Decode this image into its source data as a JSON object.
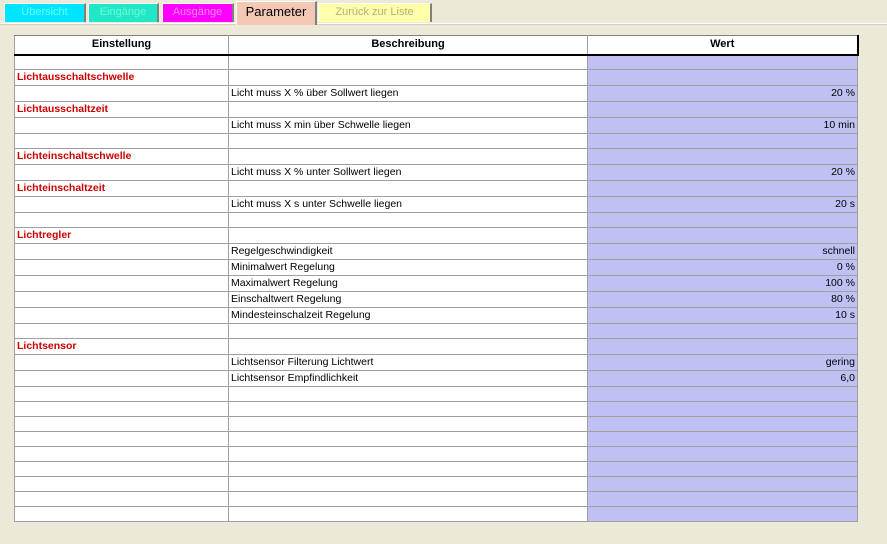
{
  "tabs": [
    {
      "label": "Übersicht",
      "bg": "#00E5FF",
      "fg": "#66FFFF"
    },
    {
      "label": "Eingänge",
      "bg": "#22E6C8",
      "fg": "#66FFCC"
    },
    {
      "label": "Ausgänge",
      "bg": "#FF00FF",
      "fg": "#FF88FF"
    },
    {
      "label": "Parameter",
      "bg": "#F4C8B4",
      "fg": "#000000"
    },
    {
      "label": "Zurück zur Liste",
      "bg": "#FFFFAA",
      "fg": "#B0B080"
    }
  ],
  "table": {
    "headers": [
      "Einstellung",
      "Beschreibung",
      "Wert"
    ],
    "rows": [
      {
        "group": "",
        "desc": "",
        "value": ""
      },
      {
        "group": "Lichtausschaltschwelle",
        "desc": "",
        "value": ""
      },
      {
        "group": "",
        "desc": "Licht muss X % über Sollwert liegen",
        "value": "20 %"
      },
      {
        "group": "Lichtausschaltzeit",
        "desc": "",
        "value": ""
      },
      {
        "group": "",
        "desc": "Licht muss X min über Schwelle liegen",
        "value": "10 min"
      },
      {
        "group": "",
        "desc": "",
        "value": ""
      },
      {
        "group": "Lichteinschaltschwelle",
        "desc": "",
        "value": ""
      },
      {
        "group": "",
        "desc": "Licht muss X % unter Sollwert liegen",
        "value": "20 %"
      },
      {
        "group": "Lichteinschaltzeit",
        "desc": "",
        "value": ""
      },
      {
        "group": "",
        "desc": "Licht muss X s unter Schwelle liegen",
        "value": "20 s"
      },
      {
        "group": "",
        "desc": "",
        "value": ""
      },
      {
        "group": "Lichtregler",
        "desc": "",
        "value": ""
      },
      {
        "group": "",
        "desc": "Regelgeschwindigkeit",
        "value": "schnell"
      },
      {
        "group": "",
        "desc": "Minimalwert Regelung",
        "value": "0 %"
      },
      {
        "group": "",
        "desc": "Maximalwert Regelung",
        "value": "100 %"
      },
      {
        "group": "",
        "desc": "Einschaltwert Regelung",
        "value": "80 %"
      },
      {
        "group": "",
        "desc": "Mindesteinschalzeit Regelung",
        "value": "10 s"
      },
      {
        "group": "",
        "desc": "",
        "value": ""
      },
      {
        "group": "Lichtsensor",
        "desc": "",
        "value": ""
      },
      {
        "group": "",
        "desc": "Lichtsensor Filterung Lichtwert",
        "value": "gering"
      },
      {
        "group": "",
        "desc": "Lichtsensor Empfindlichkeit",
        "value": "6,0"
      },
      {
        "group": "",
        "desc": "",
        "value": ""
      },
      {
        "group": "",
        "desc": "",
        "value": ""
      },
      {
        "group": "",
        "desc": "",
        "value": ""
      },
      {
        "group": "",
        "desc": "",
        "value": ""
      },
      {
        "group": "",
        "desc": "",
        "value": ""
      },
      {
        "group": "",
        "desc": "",
        "value": ""
      },
      {
        "group": "",
        "desc": "",
        "value": ""
      },
      {
        "group": "",
        "desc": "",
        "value": ""
      },
      {
        "group": "",
        "desc": "",
        "value": ""
      }
    ]
  }
}
